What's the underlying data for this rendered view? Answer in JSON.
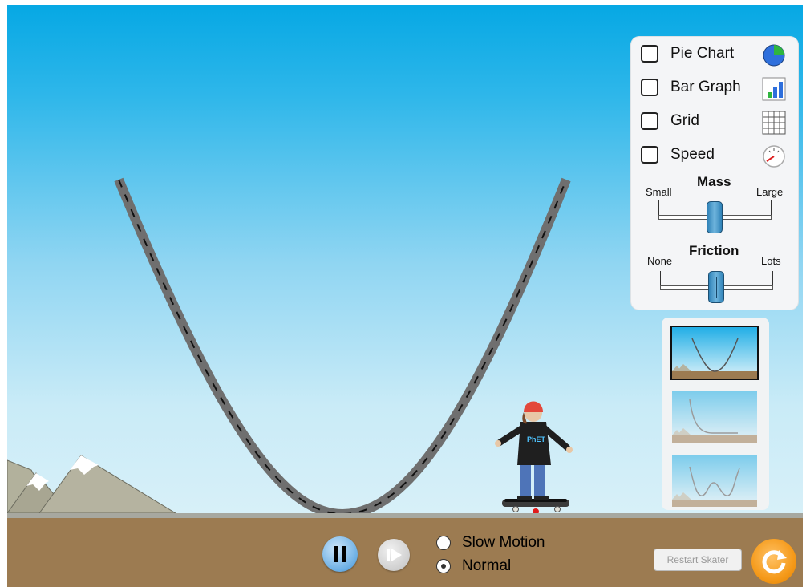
{
  "controls": {
    "checkboxes": [
      {
        "label": "Pie Chart",
        "checked": false,
        "icon": "pie-chart-icon"
      },
      {
        "label": "Bar Graph",
        "checked": false,
        "icon": "bar-graph-icon"
      },
      {
        "label": "Grid",
        "checked": false,
        "icon": "grid-icon"
      },
      {
        "label": "Speed",
        "checked": false,
        "icon": "speedometer-icon"
      }
    ],
    "mass": {
      "title": "Mass",
      "min_label": "Small",
      "max_label": "Large",
      "value": 0.5
    },
    "friction": {
      "title": "Friction",
      "min_label": "None",
      "max_label": "Lots",
      "value": 0.5
    }
  },
  "playback": {
    "pause_icon": "pause-icon",
    "step_icon": "step-forward-icon",
    "speed_options": [
      {
        "label": "Slow Motion",
        "selected": false
      },
      {
        "label": "Normal",
        "selected": true
      }
    ]
  },
  "restart_skater_label": "Restart Skater",
  "reset_icon": "reset-all-icon",
  "skater": {
    "shirt_text": "PhET"
  },
  "tracks": [
    {
      "name": "parabola",
      "selected": true
    },
    {
      "name": "slope",
      "selected": false
    },
    {
      "name": "double-well",
      "selected": false
    }
  ],
  "colors": {
    "sky_top": "#06a8e4",
    "ground": "#9c7b51",
    "slider_thumb": "#3a8cc4",
    "reset_button": "#f59a1a"
  }
}
